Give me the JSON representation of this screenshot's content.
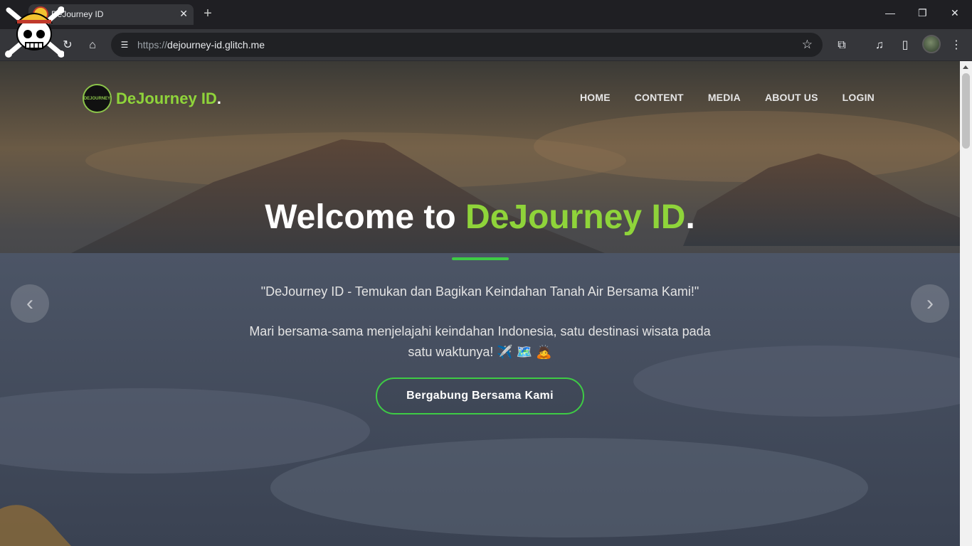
{
  "browser": {
    "tab_title": "DeJourney ID",
    "url_protocol": "https://",
    "url_host": "dejourney-id.glitch.me",
    "icons": [
      "tab-search-icon",
      "close-icon",
      "plus-icon",
      "minimize-icon",
      "restore-icon",
      "close-window-icon",
      "reload-icon",
      "home-icon",
      "tune-icon",
      "star-icon",
      "extensions-icon",
      "media-controls-icon",
      "side-panel-icon",
      "profile-avatar",
      "more-icon"
    ]
  },
  "site": {
    "brand_name": "DeJourney ID",
    "brand_dot": ".",
    "logo_text": "DEJOURNEY",
    "nav": [
      "HOME",
      "CONTENT",
      "MEDIA",
      "ABOUT US",
      "LOGIN"
    ]
  },
  "hero": {
    "title_prefix": "Welcome to ",
    "title_accent": "DeJourney ID",
    "title_suffix": ".",
    "quote": "\"DeJourney ID - Temukan dan Bagikan Keindahan Tanah Air Bersama Kami!\"",
    "description": "Mari bersama-sama menjelajahi keindahan Indonesia, satu destinasi wisata pada satu waktunya! ✈️ 🗺️ 🙇",
    "cta_label": "Bergabung Bersama Kami",
    "prev_icon": "chevron-left-icon",
    "next_icon": "chevron-right-icon"
  },
  "colors": {
    "accent_green": "#8fd43a",
    "button_border": "#3ecb45",
    "chrome_bg": "#35363a"
  }
}
